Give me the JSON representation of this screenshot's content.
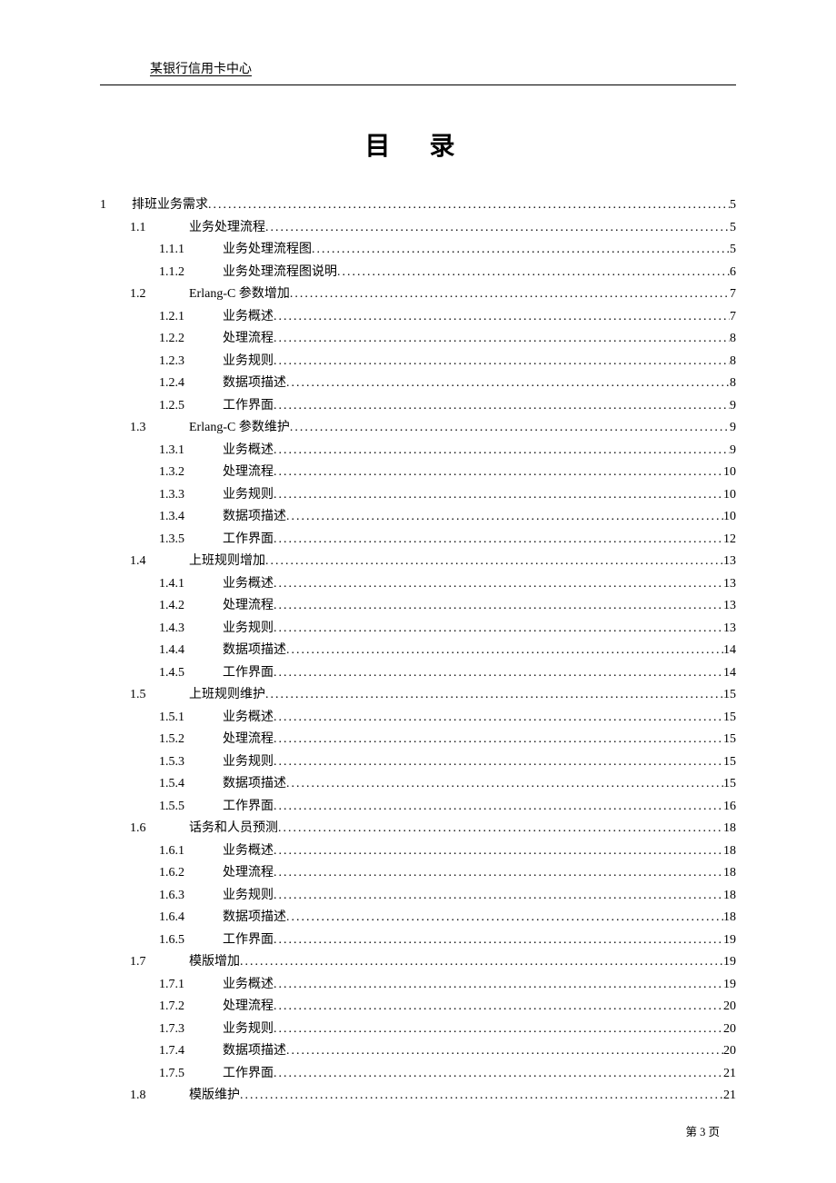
{
  "header": "某银行信用卡中心",
  "title": "目 录",
  "footer": "第 3 页",
  "toc": [
    {
      "level": 1,
      "num": "1",
      "label": "排班业务需求",
      "page": "5"
    },
    {
      "level": 2,
      "num": "1.1",
      "label": "业务处理流程",
      "page": "5"
    },
    {
      "level": 3,
      "num": "1.1.1",
      "label": "业务处理流程图",
      "page": "5"
    },
    {
      "level": 3,
      "num": "1.1.2",
      "label": "业务处理流程图说明",
      "page": "6"
    },
    {
      "level": 2,
      "num": "1.2",
      "label": "Erlang-C 参数增加",
      "page": "7"
    },
    {
      "level": 3,
      "num": "1.2.1",
      "label": "业务概述",
      "page": "7"
    },
    {
      "level": 3,
      "num": "1.2.2",
      "label": "处理流程",
      "page": "8"
    },
    {
      "level": 3,
      "num": "1.2.3",
      "label": "业务规则",
      "page": "8"
    },
    {
      "level": 3,
      "num": "1.2.4",
      "label": "数据项描述",
      "page": "8"
    },
    {
      "level": 3,
      "num": "1.2.5",
      "label": "工作界面",
      "page": "9"
    },
    {
      "level": 2,
      "num": "1.3",
      "label": "Erlang-C 参数维护",
      "page": "9"
    },
    {
      "level": 3,
      "num": "1.3.1",
      "label": "业务概述",
      "page": "9"
    },
    {
      "level": 3,
      "num": "1.3.2",
      "label": "处理流程",
      "page": "10"
    },
    {
      "level": 3,
      "num": "1.3.3",
      "label": "业务规则",
      "page": "10"
    },
    {
      "level": 3,
      "num": "1.3.4",
      "label": "数据项描述",
      "page": "10"
    },
    {
      "level": 3,
      "num": "1.3.5",
      "label": "工作界面",
      "page": "12"
    },
    {
      "level": 2,
      "num": "1.4",
      "label": "上班规则增加",
      "page": "13"
    },
    {
      "level": 3,
      "num": "1.4.1",
      "label": "业务概述",
      "page": "13"
    },
    {
      "level": 3,
      "num": "1.4.2",
      "label": "处理流程",
      "page": "13"
    },
    {
      "level": 3,
      "num": "1.4.3",
      "label": "业务规则",
      "page": "13"
    },
    {
      "level": 3,
      "num": "1.4.4",
      "label": "数据项描述",
      "page": "14"
    },
    {
      "level": 3,
      "num": "1.4.5",
      "label": "工作界面",
      "page": "14"
    },
    {
      "level": 2,
      "num": "1.5",
      "label": "上班规则维护",
      "page": "15"
    },
    {
      "level": 3,
      "num": "1.5.1",
      "label": "业务概述",
      "page": "15"
    },
    {
      "level": 3,
      "num": "1.5.2",
      "label": "处理流程",
      "page": "15"
    },
    {
      "level": 3,
      "num": "1.5.3",
      "label": "业务规则",
      "page": "15"
    },
    {
      "level": 3,
      "num": "1.5.4",
      "label": "数据项描述",
      "page": "15"
    },
    {
      "level": 3,
      "num": "1.5.5",
      "label": "工作界面",
      "page": "16"
    },
    {
      "level": 2,
      "num": "1.6",
      "label": "话务和人员预测",
      "page": "18"
    },
    {
      "level": 3,
      "num": "1.6.1",
      "label": "业务概述",
      "page": "18"
    },
    {
      "level": 3,
      "num": "1.6.2",
      "label": "处理流程",
      "page": "18"
    },
    {
      "level": 3,
      "num": "1.6.3",
      "label": "业务规则",
      "page": "18"
    },
    {
      "level": 3,
      "num": "1.6.4",
      "label": "数据项描述",
      "page": "18"
    },
    {
      "level": 3,
      "num": "1.6.5",
      "label": "工作界面",
      "page": "19"
    },
    {
      "level": 2,
      "num": "1.7",
      "label": "模版增加",
      "page": "19"
    },
    {
      "level": 3,
      "num": "1.7.1",
      "label": "业务概述",
      "page": "19"
    },
    {
      "level": 3,
      "num": "1.7.2",
      "label": "处理流程",
      "page": "20"
    },
    {
      "level": 3,
      "num": "1.7.3",
      "label": "业务规则",
      "page": "20"
    },
    {
      "level": 3,
      "num": "1.7.4",
      "label": "数据项描述",
      "page": "20"
    },
    {
      "level": 3,
      "num": "1.7.5",
      "label": "工作界面",
      "page": "21"
    },
    {
      "level": 2,
      "num": "1.8",
      "label": "模版维护",
      "page": "21"
    }
  ]
}
